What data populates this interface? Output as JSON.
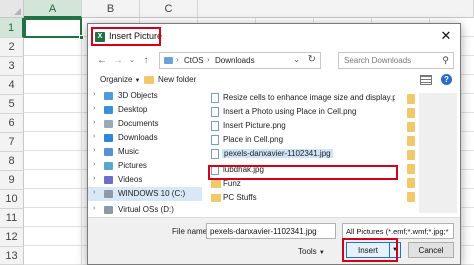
{
  "excel": {
    "columns": [
      "A",
      "B",
      "C"
    ],
    "rows": [
      "1",
      "2",
      "3",
      "4",
      "5",
      "6",
      "7",
      "8",
      "9",
      "10",
      "11",
      "12",
      "13"
    ]
  },
  "dialog": {
    "title": "Insert Picture",
    "address": {
      "crumbs": [
        "CtOS",
        "Downloads"
      ]
    },
    "search_placeholder": "Search Downloads",
    "organize_label": "Organize",
    "new_folder_label": "New folder",
    "nav_items": [
      "3D Objects",
      "Desktop",
      "Documents",
      "Downloads",
      "Music",
      "Pictures",
      "Videos",
      "WINDOWS 10 (C:)",
      "Virtual OSs (D:)"
    ],
    "files": [
      "Resize cells to enhance image size and display.png",
      "Insert a Photo using Place in Cell.png",
      "Insert Picture.png",
      "Place in Cell.png",
      "pexels-danxavier-1102341.jpg",
      "lubdhak.jpg",
      "Funz",
      "PC Stuffs"
    ],
    "filename_label": "File name:",
    "filename_value": "pexels-danxavier-1102341.jpg",
    "filter_value": "All Pictures (*.emf;*.wmf;*.jpg;*",
    "tools_label": "Tools",
    "insert_label": "Insert",
    "cancel_label": "Cancel"
  },
  "colors": {
    "excel_green": "#217346",
    "highlight_red": "#d0021b",
    "folder_yellow": "#f1c96b",
    "selection_blue": "#cde3f7"
  }
}
